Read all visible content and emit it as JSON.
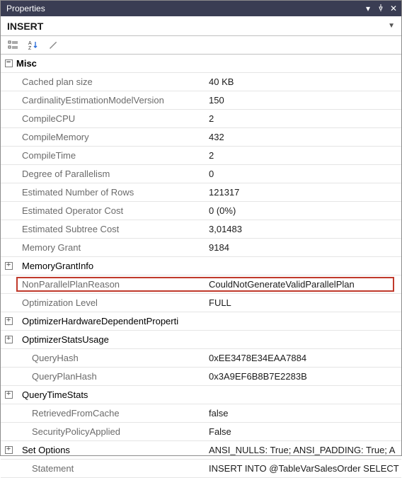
{
  "window": {
    "title": "Properties"
  },
  "subheader": {
    "text": "INSERT"
  },
  "category": {
    "label": "Misc"
  },
  "rows": [
    {
      "label": "Cached plan size",
      "value": "40 KB",
      "type": "dim"
    },
    {
      "label": "CardinalityEstimationModelVersion",
      "value": "150",
      "type": "dim"
    },
    {
      "label": "CompileCPU",
      "value": "2",
      "type": "dim"
    },
    {
      "label": "CompileMemory",
      "value": "432",
      "type": "dim"
    },
    {
      "label": "CompileTime",
      "value": "2",
      "type": "dim"
    },
    {
      "label": "Degree of Parallelism",
      "value": "0",
      "type": "dim"
    },
    {
      "label": "Estimated Number of Rows",
      "value": "121317",
      "type": "dim"
    },
    {
      "label": "Estimated Operator Cost",
      "value": "0 (0%)",
      "type": "dim"
    },
    {
      "label": "Estimated Subtree Cost",
      "value": "3,01483",
      "type": "dim"
    },
    {
      "label": "Memory Grant",
      "value": "9184",
      "type": "dim"
    },
    {
      "label": "MemoryGrantInfo",
      "value": "",
      "type": "exp"
    },
    {
      "label": "NonParallelPlanReason",
      "value": "CouldNotGenerateValidParallelPlan",
      "type": "dim",
      "highlight": true
    },
    {
      "label": "Optimization Level",
      "value": "FULL",
      "type": "dim"
    },
    {
      "label": "OptimizerHardwareDependentProperti",
      "value": "",
      "type": "exp"
    },
    {
      "label": "OptimizerStatsUsage",
      "value": "",
      "type": "exp"
    },
    {
      "label": "QueryHash",
      "value": "0xEE3478E34EAA7884",
      "type": "dim",
      "indent": true
    },
    {
      "label": "QueryPlanHash",
      "value": "0x3A9EF6B8B7E2283B",
      "type": "dim",
      "indent": true
    },
    {
      "label": "QueryTimeStats",
      "value": "",
      "type": "exp"
    },
    {
      "label": "RetrievedFromCache",
      "value": "false",
      "type": "dim",
      "indent": true
    },
    {
      "label": "SecurityPolicyApplied",
      "value": "False",
      "type": "dim",
      "indent": true
    },
    {
      "label": "Set Options",
      "value": "ANSI_NULLS: True; ANSI_PADDING: True; A",
      "type": "exp"
    },
    {
      "label": "Statement",
      "value": "INSERT INTO @TableVarSalesOrder SELECT",
      "type": "dim",
      "indent": true
    }
  ]
}
